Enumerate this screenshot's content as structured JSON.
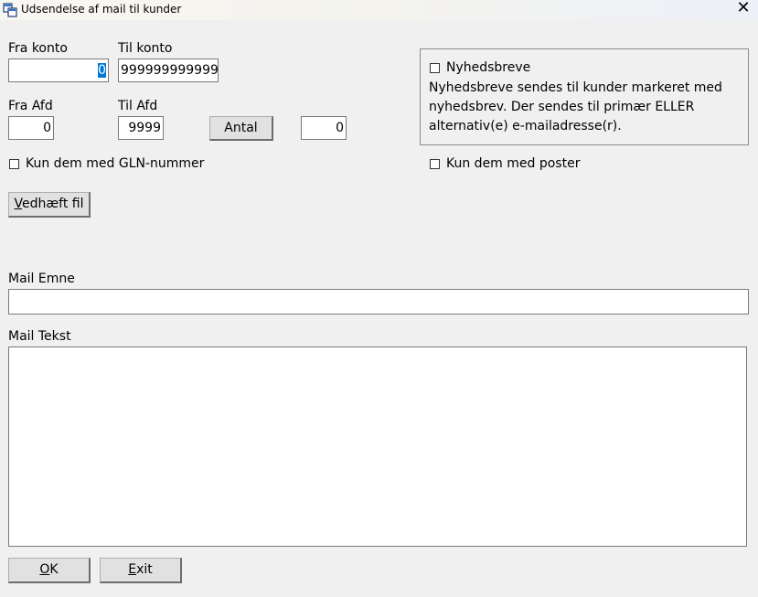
{
  "window": {
    "title": "Udsendelse af mail til kunder",
    "close_symbol": "✕"
  },
  "account": {
    "from_label": "Fra konto",
    "from_value": "",
    "from_selected": "0",
    "to_label": "Til konto",
    "to_value": "999999999999"
  },
  "department": {
    "from_label": "Fra Afd",
    "from_value": "0",
    "to_label": "Til Afd",
    "to_value": "9999"
  },
  "count": {
    "button_label": "Antal",
    "value": "0"
  },
  "options": {
    "gln_label": "Kun dem med GLN-nummer",
    "gln_checked": false,
    "posts_label": "Kun dem med poster",
    "posts_checked": false
  },
  "newsletter": {
    "label": "Nyhedsbreve",
    "checked": false,
    "description": "Nyhedsbreve sendes til kunder markeret med nyhedsbrev. Der sendes til primær ELLER alternativ(e) e-mailadresse(r)."
  },
  "attach": {
    "accel": "V",
    "rest": "edhæft fil"
  },
  "mail": {
    "subject_label": "Mail Emne",
    "subject_value": "",
    "body_label": "Mail Tekst",
    "body_value": ""
  },
  "footer": {
    "ok_accel": "O",
    "ok_rest": "K",
    "exit_accel": "E",
    "exit_rest": "xit"
  }
}
